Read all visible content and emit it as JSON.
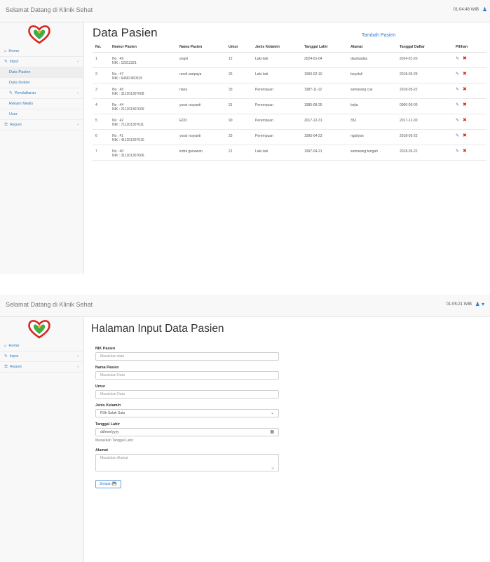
{
  "panel1": {
    "brand": "Selamat Datang di Klinik Sehat",
    "clock": "01:04:48 WIB",
    "nav": [
      {
        "label": "Home",
        "icon": "home-icon"
      },
      {
        "label": "Input",
        "icon": "edit-icon",
        "arrow": "‹"
      },
      {
        "label": "Data Pasien"
      },
      {
        "label": "Data Dokter"
      },
      {
        "label": "Pendaftaran",
        "icon": "edit-icon",
        "arrow": "‹"
      },
      {
        "label": "Rekam Medis"
      },
      {
        "label": "User"
      },
      {
        "label": "Report",
        "icon": "list-icon",
        "arrow": "‹"
      }
    ],
    "title": "Data Pasien",
    "add_link": "Tambah Pasien",
    "columns": [
      "No.",
      "Nomor Pasien",
      "Nama Pasien",
      "Umur",
      "Jenis Kelamin",
      "Tanggal Lahir",
      "Alamat",
      "Tanggal Daftar",
      "Pilihan"
    ],
    "rows": [
      {
        "no": "1",
        "nomor": "No : 49",
        "nik": "NIK : 12312321",
        "nama": "angel",
        "umur": "12",
        "jk": "Laki-laki",
        "lahir": "2024-01-04",
        "alamat": "dasdsadas",
        "daftar": "2024-01-20"
      },
      {
        "no": "2",
        "nomor": "No : 47",
        "nik": "NIK : 64687460515",
        "nama": "randi saepaya",
        "umur": "25",
        "jk": "Laki-laki",
        "lahir": "1993-02-10",
        "alamat": "boyolali",
        "daftar": "2018-05-29"
      },
      {
        "no": "3",
        "nomor": "No : 45",
        "nik": "NIK : 311201307608",
        "nama": "nana",
        "umur": "33",
        "jk": "Perempuan",
        "lahir": "1987-11-12",
        "alamat": "semarang cuy",
        "daftar": "2018-05-22"
      },
      {
        "no": "4",
        "nomor": "No : 44",
        "nik": "NIK : 211201307609",
        "nama": "yossi rosyanti",
        "umur": "31",
        "jk": "Perempuan",
        "lahir": "1985-08-25",
        "alamat": "bojia",
        "daftar": "0000-00-00"
      },
      {
        "no": "5",
        "nomor": "No : 42",
        "nik": "NIK : 711201307611",
        "nama": "EDO",
        "umur": "90",
        "jk": "Perempuan",
        "lahir": "2017-12-31",
        "alamat": "352",
        "daftar": "2017-12-30"
      },
      {
        "no": "6",
        "nomor": "No : 41",
        "nik": "NIK : 411201307610",
        "nama": "yossi rosyanti",
        "umur": "23",
        "jk": "Perempuan",
        "lahir": "1995-04-23",
        "alamat": "ngaliyan",
        "daftar": "2018-05-22"
      },
      {
        "no": "7",
        "nomor": "No : 40",
        "nik": "NIK : 311201307606",
        "nama": "indra gunawan",
        "umur": "21",
        "jk": "Laki-laki",
        "lahir": "1997-04-21",
        "alamat": "semarang tengah",
        "daftar": "2018-05-22"
      }
    ]
  },
  "panel2": {
    "brand": "Selamat Datang di Klinik Sehat",
    "clock": "01:05:21 WIB",
    "nav": [
      {
        "label": "Home",
        "icon": "home-icon"
      },
      {
        "label": "Input",
        "icon": "edit-icon",
        "arrow": "‹"
      },
      {
        "label": "Report",
        "icon": "list-icon",
        "arrow": "‹"
      }
    ],
    "title": "Halaman Input Data Pasien",
    "fields": {
      "nik_label": "NIK Pasien",
      "nik_placeholder": "Masukkan data",
      "nama_label": "Nama Pasien",
      "nama_placeholder": "Masukkan Data",
      "umur_label": "Umur",
      "umur_placeholder": "Masukkan Data",
      "jk_label": "Jenis Kelamin",
      "jk_selected": "Pilih Salah Satu",
      "lahir_label": "Tanggal Lahir",
      "lahir_placeholder": "dd/mm/yyyy",
      "lahir_help": "Masukkan Tanggal Lahir",
      "alamat_label": "Alamat",
      "alamat_placeholder": "Masukkan Alamat",
      "submit": "Simpan"
    }
  },
  "colors": {
    "accent": "#2b7bd0",
    "danger": "#d9241f",
    "sidebar_bg": "#f8f8f8"
  }
}
